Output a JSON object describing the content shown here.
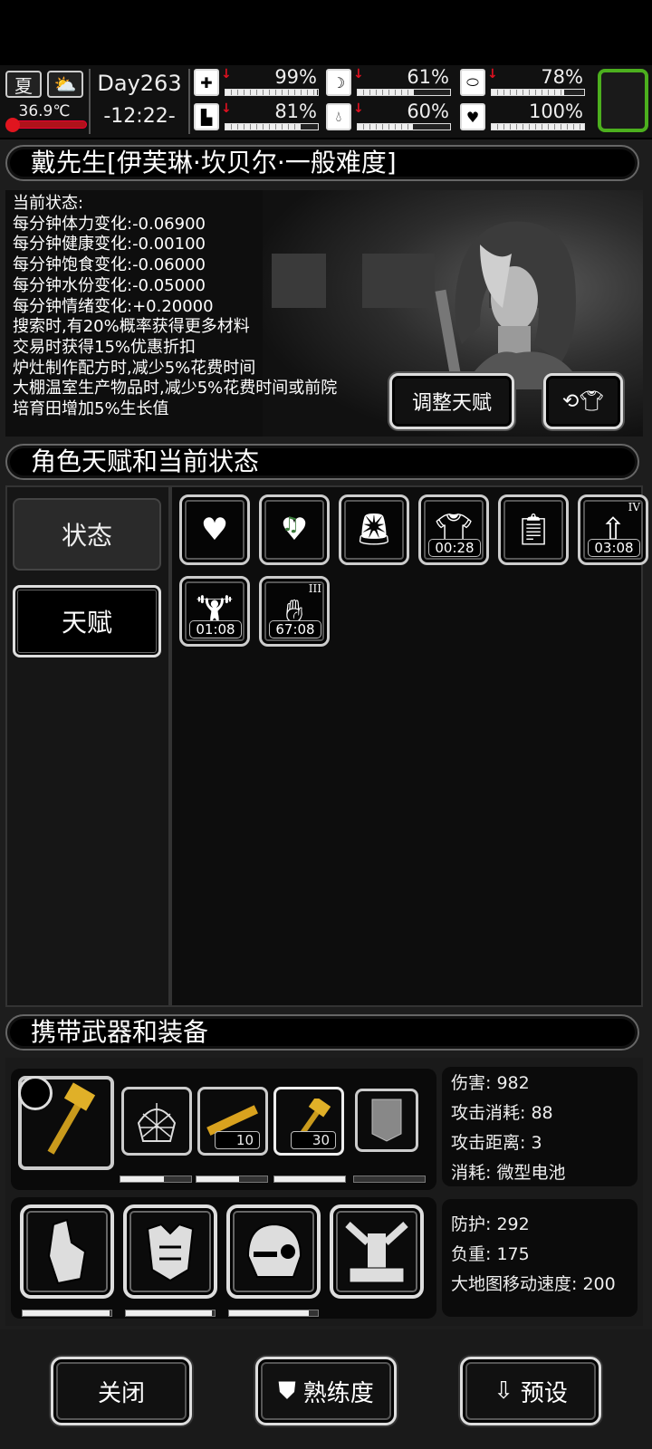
{
  "status_bar": {
    "season": "夏",
    "temperature": "36.9℃",
    "day": "Day263",
    "time": "-12:22-",
    "stats": [
      {
        "name": "health",
        "icon": "medkit-icon",
        "value": "99%",
        "level": 0.99,
        "decreasing": true
      },
      {
        "name": "stomach",
        "icon": "stomach-icon",
        "value": "61%",
        "level": 0.61,
        "decreasing": true
      },
      {
        "name": "stamina",
        "icon": "pill-icon",
        "value": "78%",
        "level": 0.78,
        "decreasing": true
      },
      {
        "name": "leg",
        "icon": "boot-icon",
        "value": "81%",
        "level": 0.81,
        "decreasing": true
      },
      {
        "name": "water",
        "icon": "water-drop-icon",
        "value": "60%",
        "level": 0.6,
        "decreasing": true
      },
      {
        "name": "mood",
        "icon": "heart-icon",
        "value": "100%",
        "level": 1.0,
        "decreasing": false
      }
    ]
  },
  "character": {
    "header": "戴先生[伊芙琳·坎贝尔·一般难度]",
    "status_lines": [
      "当前状态:",
      "每分钟体力变化:-0.06900",
      "每分钟健康变化:-0.00100",
      "每分钟饱食变化:-0.06000",
      "每分钟水份变化:-0.05000",
      "每分钟情绪变化:+0.20000",
      "搜索时,有20%概率获得更多材料",
      "交易时获得15%优惠折扣",
      "炉灶制作配方时,减少5%花费时间",
      "大棚温室生产物品时,减少5%花费时间或前院",
      "培育田增加5%生长值"
    ],
    "adjust_talent_label": "调整天赋"
  },
  "talents": {
    "header": "角色天赋和当前状态",
    "tabs": [
      "状态",
      "天赋"
    ],
    "status_icons": [
      {
        "icon": "heart-icon",
        "timer": "",
        "roman": ""
      },
      {
        "icon": "music-heart-icon",
        "timer": "",
        "roman": ""
      },
      {
        "icon": "alarm-light-icon",
        "timer": "",
        "roman": ""
      },
      {
        "icon": "shirt-icon",
        "timer": "00:28",
        "roman": ""
      },
      {
        "icon": "medicine-icon",
        "timer": "",
        "roman": ""
      },
      {
        "icon": "bottle-up-icon",
        "timer": "03:08",
        "roman": "IV"
      },
      {
        "icon": "muscle-meter-icon",
        "timer": "01:08",
        "roman": ""
      },
      {
        "icon": "hand-icon",
        "timer": "67:08",
        "roman": "III"
      }
    ]
  },
  "equipment": {
    "header": "携带武器和装备",
    "weapon_counts": [
      "10",
      "30"
    ],
    "weapon_durability": [
      0.62,
      0.6,
      1.0,
      0.0
    ],
    "weapon_stats": [
      "伤害: 982",
      "攻击消耗: 88",
      "攻击距离: 3",
      "消耗: 微型电池"
    ],
    "armor_durability": [
      0.98,
      0.97,
      0.9
    ],
    "armor_stats": [
      "防护: 292",
      "负重: 175",
      "大地图移动速度: 200"
    ]
  },
  "buttons": {
    "close": "关闭",
    "proficiency": "熟练度",
    "preset": "预设"
  }
}
